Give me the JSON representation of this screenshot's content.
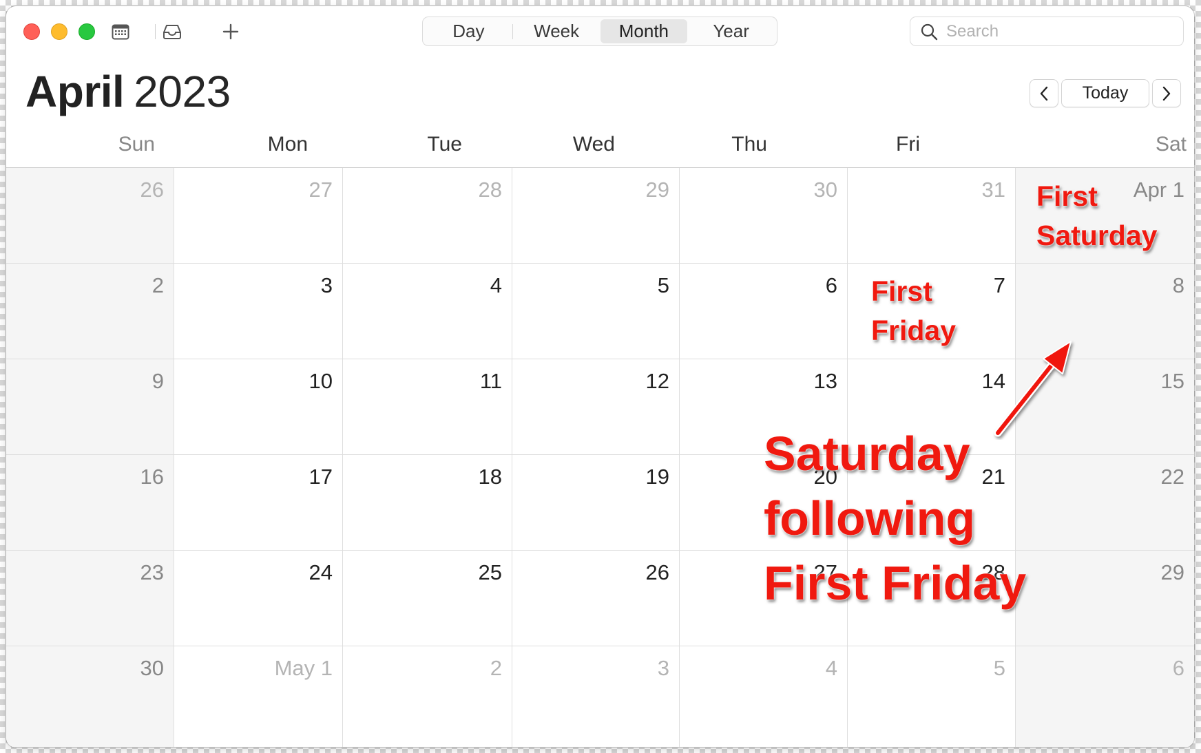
{
  "toolbar": {
    "calendar_icon": "calendar-icon",
    "inbox_icon": "inbox-icon",
    "add_icon": "plus-icon",
    "views": [
      {
        "label": "Day",
        "active": false
      },
      {
        "label": "Week",
        "active": false
      },
      {
        "label": "Month",
        "active": true
      },
      {
        "label": "Year",
        "active": false
      }
    ],
    "search": {
      "placeholder": "Search",
      "icon": "search-icon"
    }
  },
  "header": {
    "month": "April",
    "year": "2023",
    "prev_icon": "chevron-left-icon",
    "today_label": "Today",
    "next_icon": "chevron-right-icon"
  },
  "weekdays": [
    "Sun",
    "Mon",
    "Tue",
    "Wed",
    "Thu",
    "Fri",
    "Sat"
  ],
  "weeks": [
    [
      {
        "label": "26",
        "other": true
      },
      {
        "label": "27",
        "other": true
      },
      {
        "label": "28",
        "other": true
      },
      {
        "label": "29",
        "other": true
      },
      {
        "label": "30",
        "other": true
      },
      {
        "label": "31",
        "other": true
      },
      {
        "label": "Apr 1",
        "other": false
      }
    ],
    [
      {
        "label": "2"
      },
      {
        "label": "3"
      },
      {
        "label": "4"
      },
      {
        "label": "5"
      },
      {
        "label": "6"
      },
      {
        "label": "7"
      },
      {
        "label": "8"
      }
    ],
    [
      {
        "label": "9"
      },
      {
        "label": "10"
      },
      {
        "label": "11"
      },
      {
        "label": "12"
      },
      {
        "label": "13"
      },
      {
        "label": "14"
      },
      {
        "label": "15"
      }
    ],
    [
      {
        "label": "16"
      },
      {
        "label": "17"
      },
      {
        "label": "18"
      },
      {
        "label": "19"
      },
      {
        "label": "20"
      },
      {
        "label": "21"
      },
      {
        "label": "22"
      }
    ],
    [
      {
        "label": "23"
      },
      {
        "label": "24"
      },
      {
        "label": "25"
      },
      {
        "label": "26"
      },
      {
        "label": "27"
      },
      {
        "label": "28"
      },
      {
        "label": "29"
      }
    ],
    [
      {
        "label": "30"
      },
      {
        "label": "May 1",
        "other": true
      },
      {
        "label": "2",
        "other": true
      },
      {
        "label": "3",
        "other": true
      },
      {
        "label": "4",
        "other": true
      },
      {
        "label": "5",
        "other": true
      },
      {
        "label": "6",
        "other": true
      }
    ]
  ],
  "annotations": {
    "first_saturday": [
      "First",
      "Saturday"
    ],
    "first_friday": [
      "First",
      "Friday"
    ],
    "callout": [
      "Saturday",
      "following",
      "First Friday"
    ],
    "color": "#f0190f"
  },
  "colors": {
    "close": "#ff5f57",
    "minimize": "#febc2e",
    "zoom": "#28c840"
  }
}
